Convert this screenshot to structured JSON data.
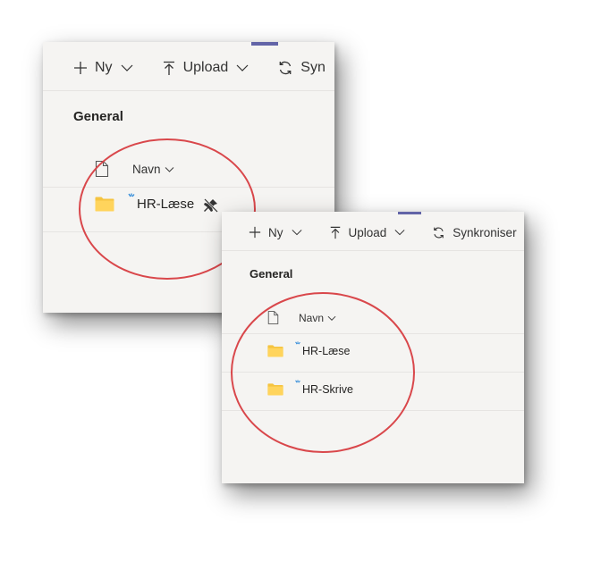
{
  "accent_color": "#6264a7",
  "annotation_color": "#d9474b",
  "panel_top": {
    "toolbar": {
      "new_label": "Ny",
      "upload_label": "Upload",
      "sync_label": "Syn"
    },
    "section_title": "General",
    "column_name_label": "Navn",
    "rows": [
      {
        "name": "HR-Læse",
        "icon": "folder-icon",
        "badge": "sync-icon",
        "extra_icon": "pin-off-icon"
      }
    ]
  },
  "panel_bottom": {
    "toolbar": {
      "new_label": "Ny",
      "upload_label": "Upload",
      "sync_label": "Synkroniser"
    },
    "section_title": "General",
    "column_name_label": "Navn",
    "rows": [
      {
        "name": "HR-Læse",
        "icon": "folder-icon",
        "badge": "sync-icon"
      },
      {
        "name": "HR-Skrive",
        "icon": "folder-icon",
        "badge": "sync-icon"
      }
    ]
  }
}
